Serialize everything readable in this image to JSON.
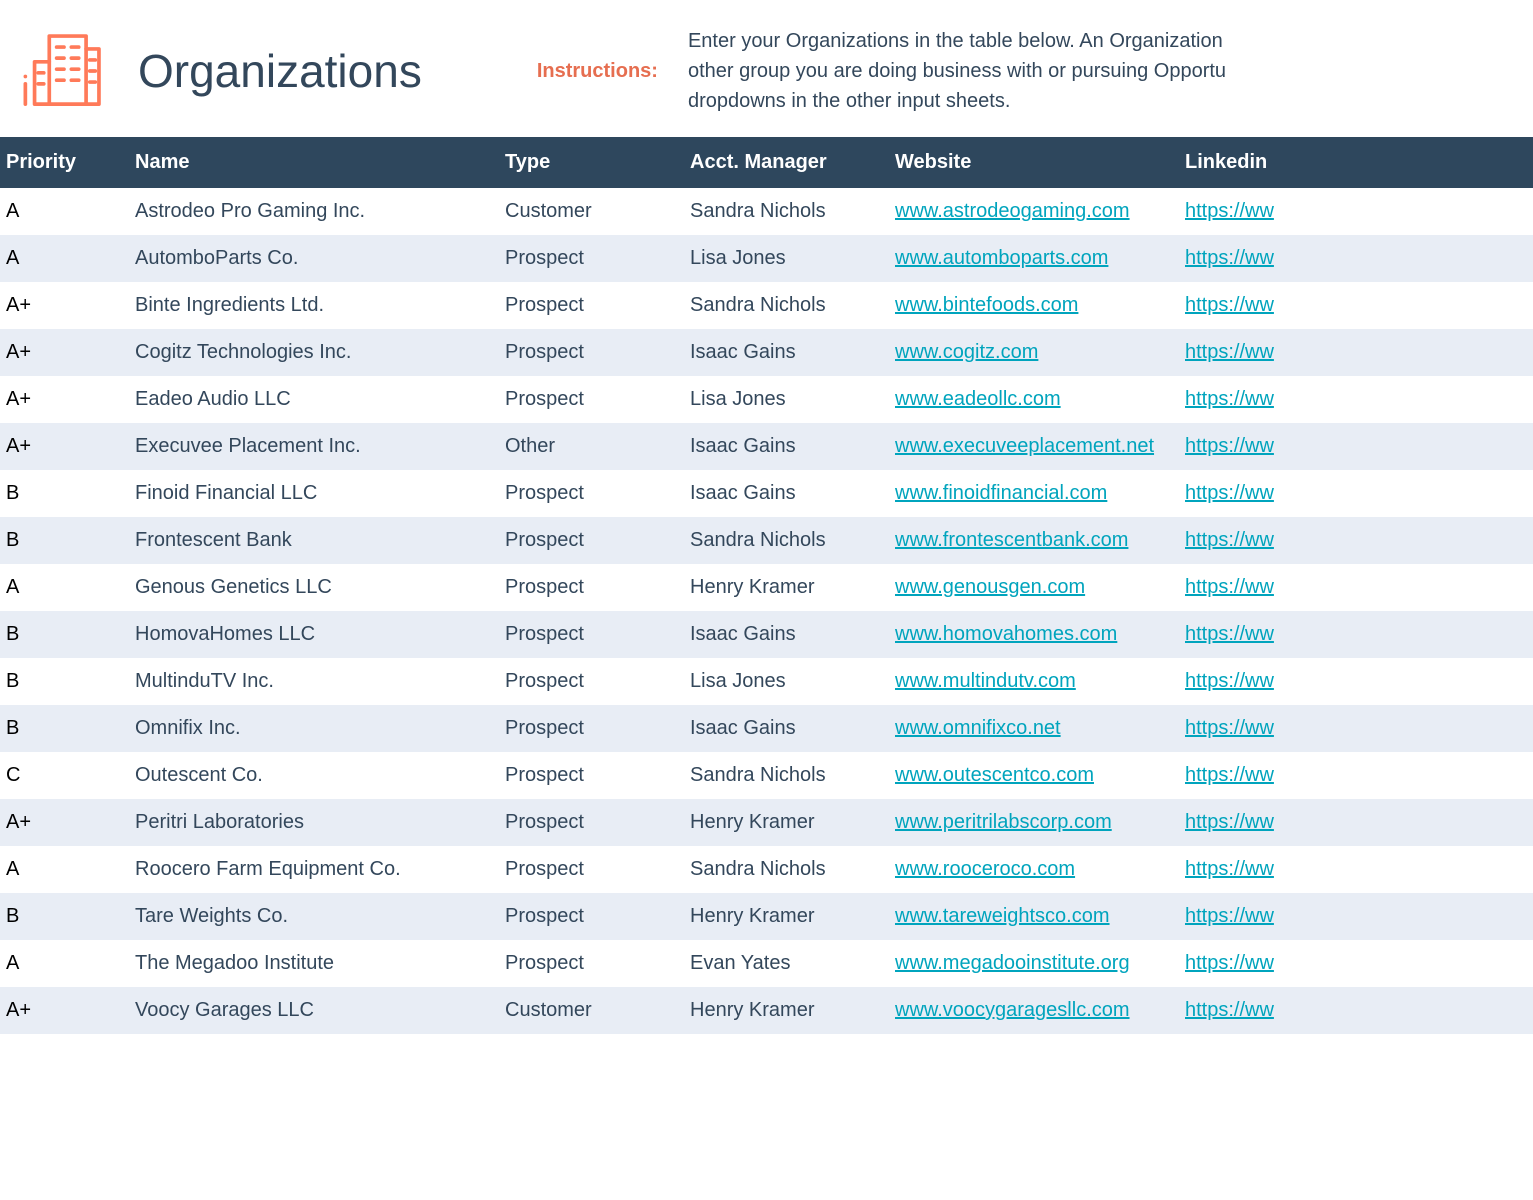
{
  "header": {
    "title": "Organizations",
    "instructions_label": "Instructions:",
    "instructions_text": "Enter your Organizations in the table below. An Organization other group you are doing business with or pursuing Opportu dropdowns in the other input sheets."
  },
  "columns": {
    "priority": "Priority",
    "name": "Name",
    "type": "Type",
    "manager": "Acct. Manager",
    "website": "Website",
    "linkedin": "Linkedin"
  },
  "rows": [
    {
      "priority": "A",
      "name": "Astrodeo Pro Gaming Inc.",
      "type": "Customer",
      "manager": "Sandra Nichols",
      "website": "www.astrodeogaming.com",
      "linkedin": "https://ww"
    },
    {
      "priority": "A",
      "name": "AutomboParts Co.",
      "type": "Prospect",
      "manager": "Lisa Jones",
      "website": "www.automboparts.com",
      "linkedin": "https://ww"
    },
    {
      "priority": "A+",
      "name": "Binte Ingredients Ltd.",
      "type": "Prospect",
      "manager": "Sandra Nichols",
      "website": "www.bintefoods.com",
      "linkedin": "https://ww"
    },
    {
      "priority": "A+",
      "name": "Cogitz Technologies Inc.",
      "type": "Prospect",
      "manager": "Isaac Gains",
      "website": "www.cogitz.com",
      "linkedin": "https://ww"
    },
    {
      "priority": "A+",
      "name": "Eadeo Audio LLC",
      "type": "Prospect",
      "manager": "Lisa Jones",
      "website": "www.eadeollc.com",
      "linkedin": "https://ww"
    },
    {
      "priority": "A+",
      "name": "Execuvee Placement Inc.",
      "type": "Other",
      "manager": "Isaac Gains",
      "website": "www.execuveeplacement.net",
      "linkedin": "https://ww"
    },
    {
      "priority": "B",
      "name": "Finoid Financial LLC",
      "type": "Prospect",
      "manager": "Isaac Gains",
      "website": "www.finoidfinancial.com",
      "linkedin": "https://ww"
    },
    {
      "priority": "B",
      "name": "Frontescent Bank",
      "type": "Prospect",
      "manager": "Sandra Nichols",
      "website": "www.frontescentbank.com",
      "linkedin": "https://ww"
    },
    {
      "priority": "A",
      "name": "Genous Genetics LLC",
      "type": "Prospect",
      "manager": "Henry Kramer",
      "website": "www.genousgen.com",
      "linkedin": "https://ww"
    },
    {
      "priority": "B",
      "name": "HomovaHomes LLC",
      "type": "Prospect",
      "manager": "Isaac Gains",
      "website": "www.homovahomes.com",
      "linkedin": "https://ww"
    },
    {
      "priority": "B",
      "name": "MultinduTV Inc.",
      "type": "Prospect",
      "manager": "Lisa Jones",
      "website": "www.multindutv.com",
      "linkedin": "https://ww"
    },
    {
      "priority": "B",
      "name": "Omnifix Inc.",
      "type": "Prospect",
      "manager": "Isaac Gains",
      "website": "www.omnifixco.net",
      "linkedin": "https://ww"
    },
    {
      "priority": "C",
      "name": "Outescent Co.",
      "type": "Prospect",
      "manager": "Sandra Nichols",
      "website": "www.outescentco.com",
      "linkedin": "https://ww"
    },
    {
      "priority": "A+",
      "name": "Peritri Laboratories",
      "type": "Prospect",
      "manager": "Henry Kramer",
      "website": "www.peritrilabscorp.com",
      "linkedin": "https://ww"
    },
    {
      "priority": "A",
      "name": "Roocero Farm Equipment Co.",
      "type": "Prospect",
      "manager": "Sandra Nichols",
      "website": "www.rooceroco.com",
      "linkedin": "https://ww"
    },
    {
      "priority": "B",
      "name": "Tare Weights Co.",
      "type": "Prospect",
      "manager": "Henry Kramer",
      "website": "www.tareweightsco.com",
      "linkedin": "https://ww"
    },
    {
      "priority": "A",
      "name": "The Megadoo Institute",
      "type": "Prospect",
      "manager": "Evan Yates",
      "website": "www.megadooinstitute.org",
      "linkedin": "https://ww"
    },
    {
      "priority": "A+",
      "name": "Voocy Garages LLC",
      "type": "Customer",
      "manager": "Henry Kramer",
      "website": "www.voocygaragesllc.com",
      "linkedin": "https://ww"
    }
  ]
}
